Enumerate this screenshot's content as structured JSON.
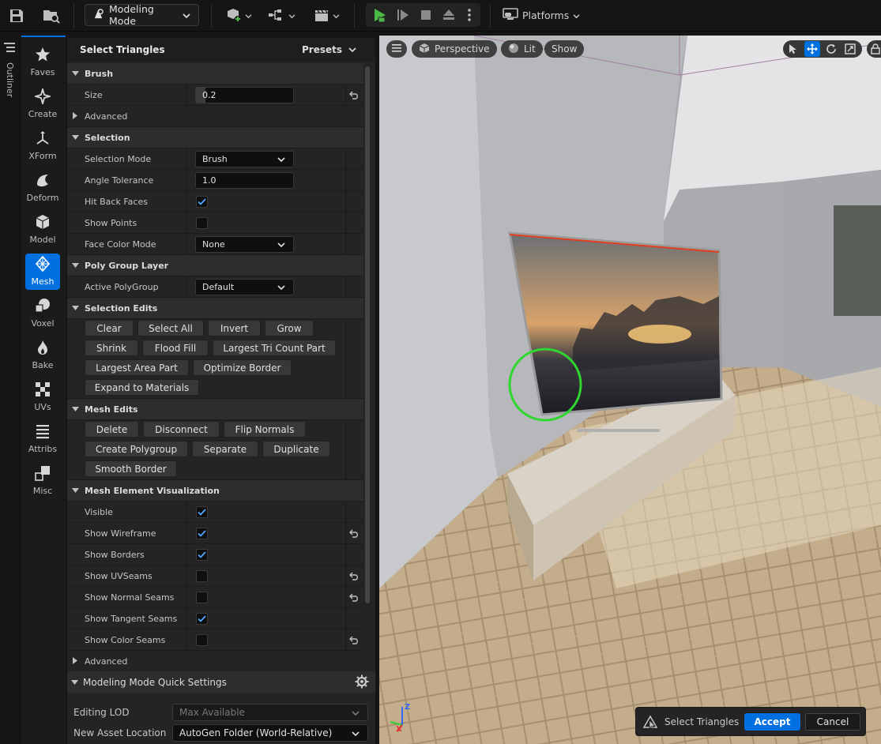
{
  "toolbar": {
    "mode_label": "Modeling Mode",
    "platforms_label": "Platforms"
  },
  "outliner_label": "Outliner",
  "palette": [
    {
      "label": "Faves",
      "icon": "star-icon"
    },
    {
      "label": "Create",
      "icon": "create-icon"
    },
    {
      "label": "XForm",
      "icon": "xform-icon"
    },
    {
      "label": "Deform",
      "icon": "deform-icon"
    },
    {
      "label": "Model",
      "icon": "model-icon"
    },
    {
      "label": "Mesh",
      "icon": "mesh-icon"
    },
    {
      "label": "Voxel",
      "icon": "voxel-icon"
    },
    {
      "label": "Bake",
      "icon": "bake-icon"
    },
    {
      "label": "UVs",
      "icon": "uvs-icon"
    },
    {
      "label": "Attribs",
      "icon": "attribs-icon"
    },
    {
      "label": "Misc",
      "icon": "misc-icon"
    }
  ],
  "panel": {
    "title": "Select Triangles",
    "presets_label": "Presets",
    "brush": {
      "header": "Brush",
      "size_label": "Size",
      "size_value": "0.2",
      "size_fill": 0.1,
      "advanced": "Advanced"
    },
    "selection": {
      "header": "Selection",
      "mode_label": "Selection Mode",
      "mode_value": "Brush",
      "angle_label": "Angle Tolerance",
      "angle_value": "1.0",
      "hit_label": "Hit Back Faces",
      "hit_checked": true,
      "points_label": "Show Points",
      "points_checked": false,
      "face_color_label": "Face Color Mode",
      "face_color_value": "None"
    },
    "poly": {
      "header": "Poly Group Layer",
      "active_label": "Active PolyGroup",
      "active_value": "Default"
    },
    "sel_edits": {
      "header": "Selection Edits",
      "buttons": [
        "Clear",
        "Select All",
        "Invert",
        "Grow",
        "Shrink",
        "Flood Fill",
        "Largest Tri Count Part",
        "Largest Area Part",
        "Optimize Border",
        "Expand to Materials"
      ]
    },
    "mesh_edits": {
      "header": "Mesh Edits",
      "buttons": [
        "Delete",
        "Disconnect",
        "Flip Normals",
        "Create Polygroup",
        "Separate",
        "Duplicate",
        "Smooth Border"
      ]
    },
    "vis": {
      "header": "Mesh Element Visualization",
      "rows": [
        {
          "label": "Visible",
          "checked": true,
          "reset": false
        },
        {
          "label": "Show Wireframe",
          "checked": true,
          "reset": true
        },
        {
          "label": "Show Borders",
          "checked": true,
          "reset": false
        },
        {
          "label": "Show UVSeams",
          "checked": false,
          "reset": true
        },
        {
          "label": "Show Normal Seams",
          "checked": false,
          "reset": true
        },
        {
          "label": "Show Tangent Seams",
          "checked": true,
          "reset": false
        },
        {
          "label": "Show Color Seams",
          "checked": false,
          "reset": true
        }
      ],
      "advanced": "Advanced"
    }
  },
  "quick": {
    "header": "Modeling Mode Quick Settings",
    "lod_label": "Editing LOD",
    "lod_value": "Max Available",
    "asset_label": "New Asset Location",
    "asset_value": "AutoGen Folder (World-Relative)"
  },
  "viewport": {
    "perspective": "Perspective",
    "lit": "Lit",
    "show": "Show",
    "axis_z": "Z",
    "axis_x": "X"
  },
  "accept_bar": {
    "label": "Select Triangles",
    "accept": "Accept",
    "cancel": "Cancel"
  },
  "colors": {
    "accent": "#0070e0",
    "play_green": "#4cb848",
    "brush_circle": "#2fd62f"
  }
}
